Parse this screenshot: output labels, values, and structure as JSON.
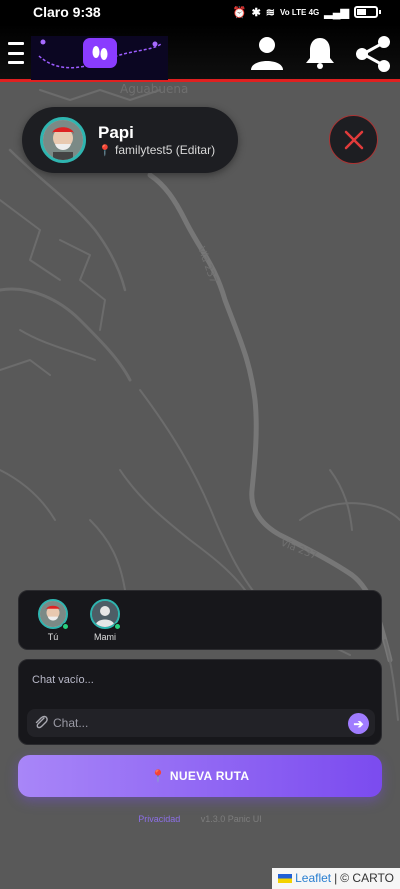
{
  "status_bar": {
    "carrier_time": "Claro 9:38",
    "network": "Vo LTE 4G"
  },
  "app_bar": {
    "menu_icon": "hamburger-icon",
    "logo_icon": "footprints-logo",
    "icons": [
      "user-icon",
      "bell-icon",
      "share-icon"
    ],
    "accent_color": "#e02020"
  },
  "map": {
    "place_label": "Aguabuena",
    "road_labels": [
      "Vía 237",
      "Vía 237"
    ]
  },
  "profile": {
    "name": "Papi",
    "location_text": "familytest5 (Editar)"
  },
  "members": [
    {
      "label": "Tú",
      "online": true
    },
    {
      "label": "Mami",
      "online": true
    }
  ],
  "chat": {
    "empty_text": "Chat vacío...",
    "input_placeholder": "Chat...",
    "send_icon": "arrow-right-icon"
  },
  "new_route": {
    "label": "NUEVA RUTA",
    "colors": [
      "#a886f8",
      "#7b4bef"
    ]
  },
  "footer": {
    "privacy_label": "Privacidad",
    "version": "v1.3.0 Panic UI"
  },
  "attribution": {
    "leaflet_label": "Leaflet",
    "separator": "|",
    "carto_label": "© CARTO"
  }
}
